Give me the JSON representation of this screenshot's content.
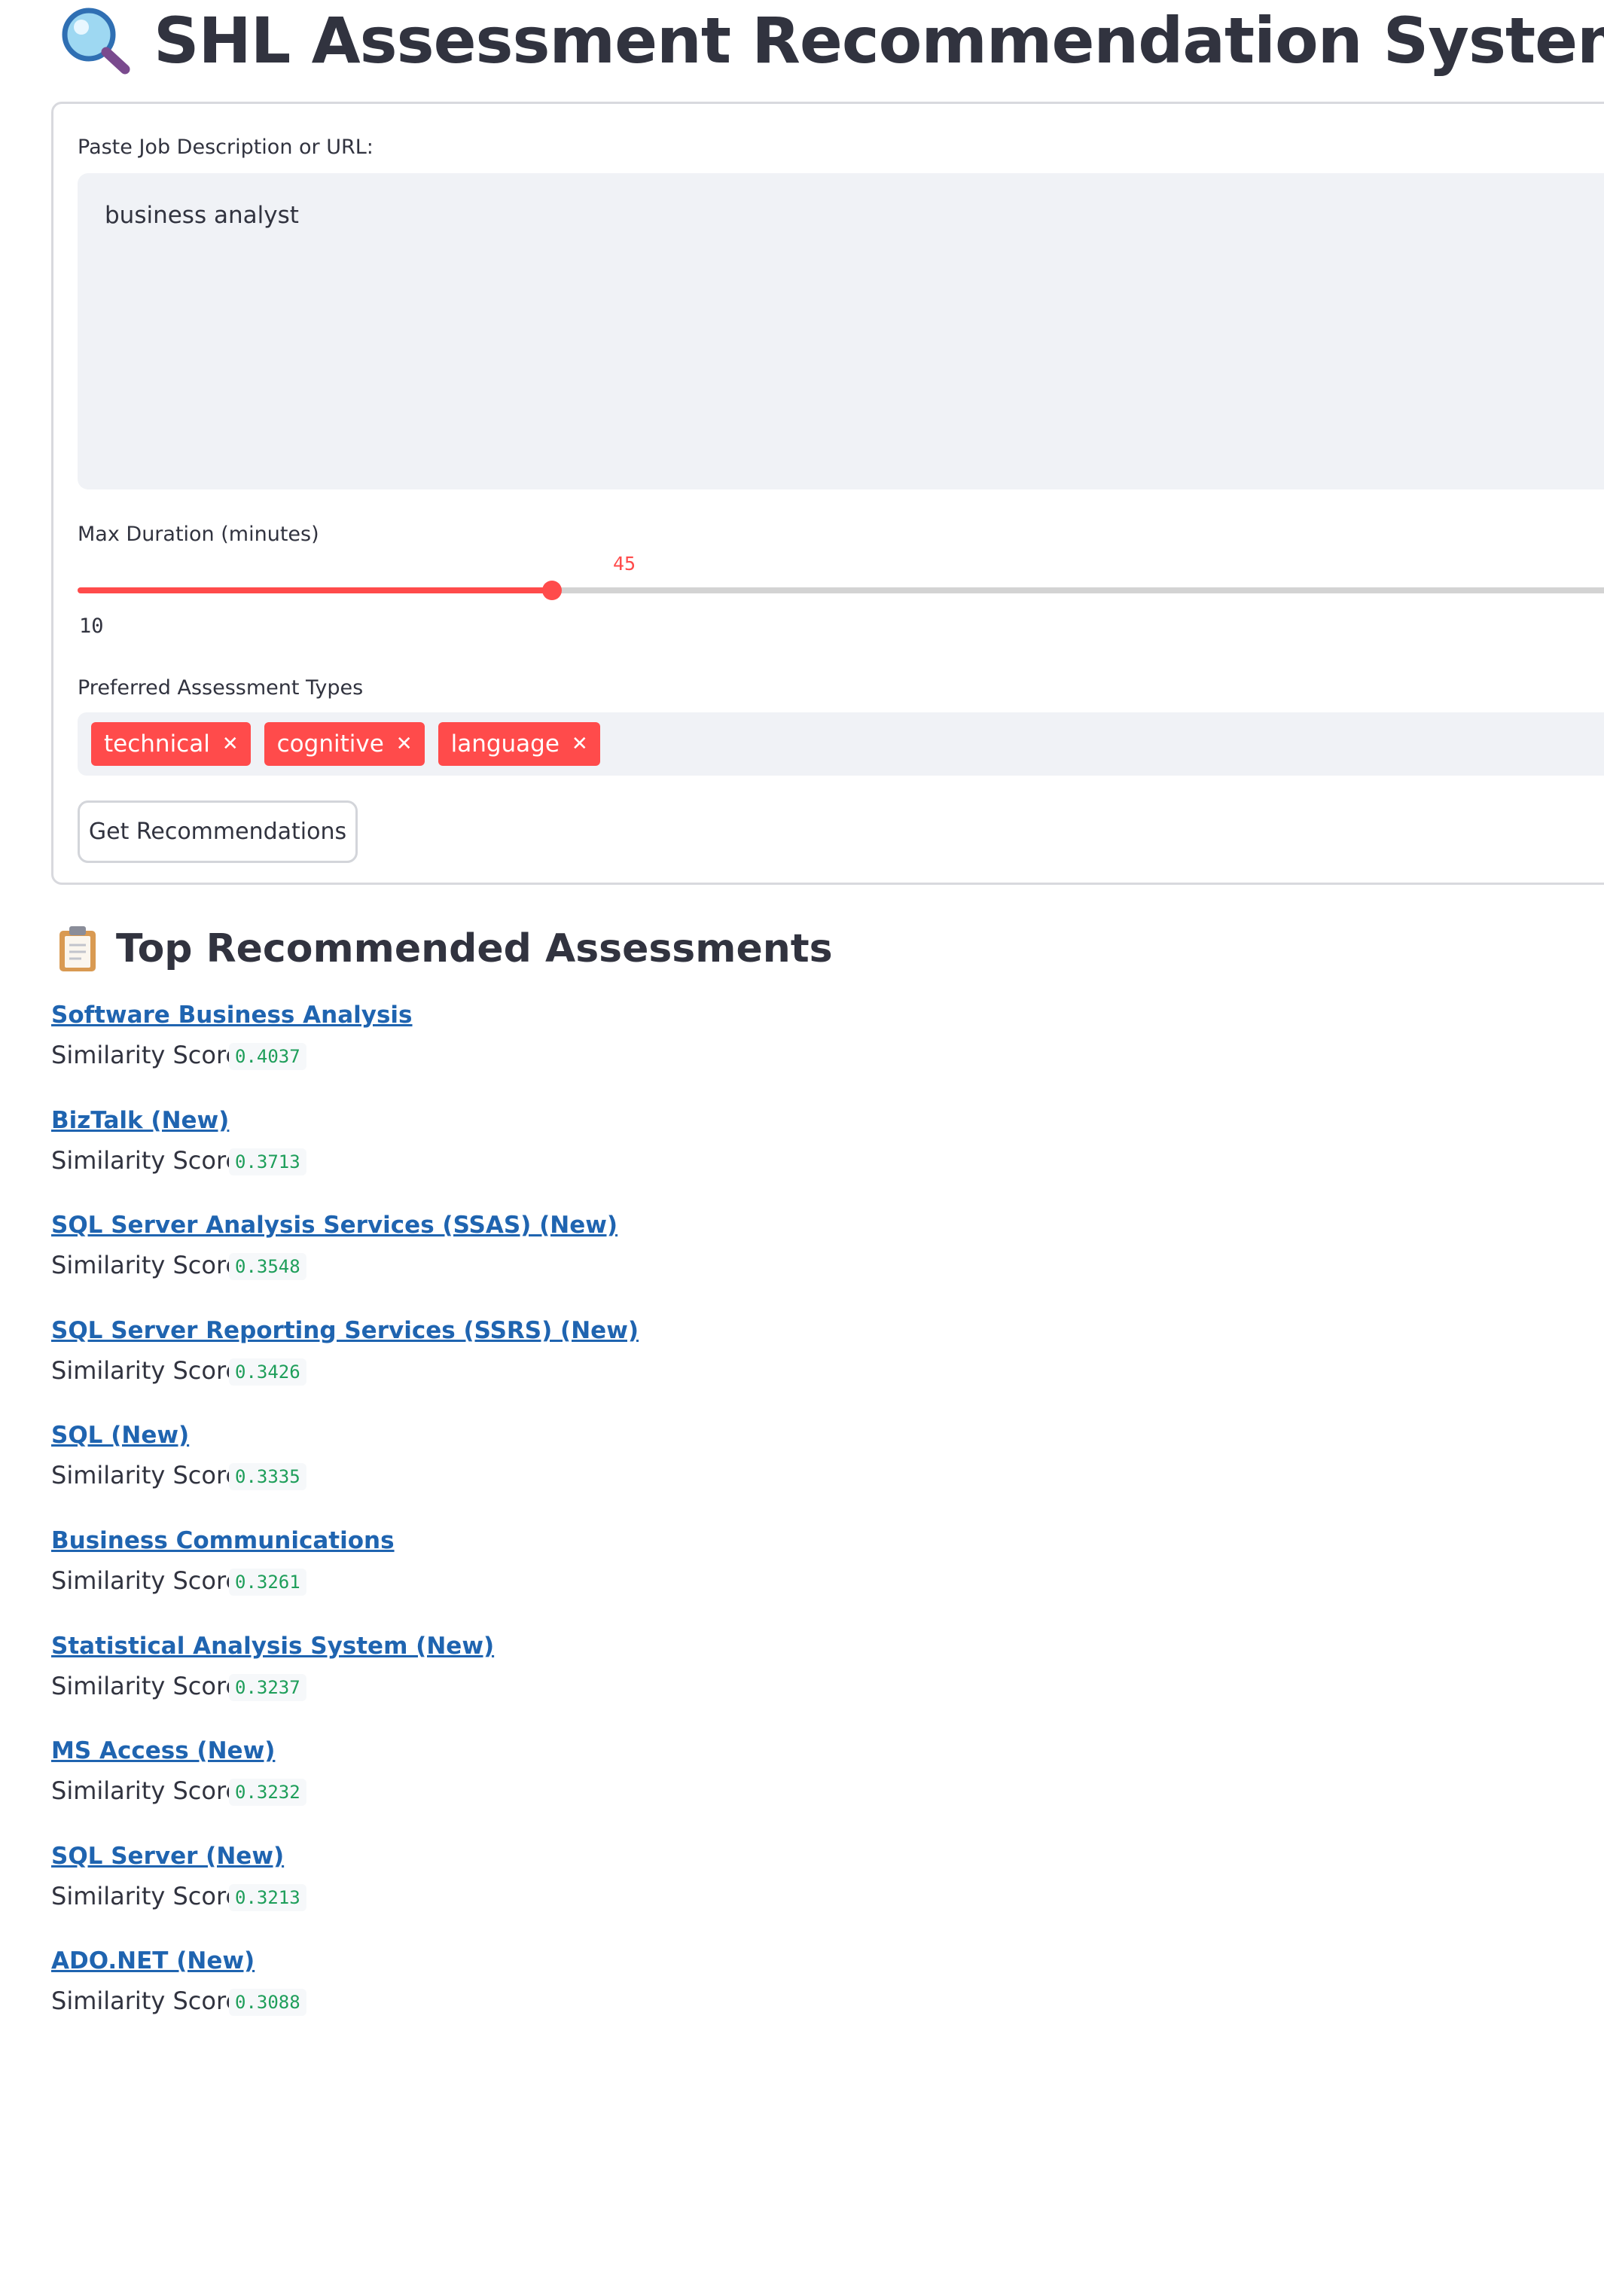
{
  "header": {
    "title": "SHL Assessment Recommendation System",
    "icon": "magnifying-glass-icon"
  },
  "form": {
    "jd_label": "Paste Job Description or URL:",
    "jd_value": "business analyst",
    "duration_label": "Max Duration (minutes)",
    "duration_value": "45",
    "duration_min_label": "10",
    "duration_fraction": 0.3,
    "types_label": "Preferred Assessment Types",
    "types_selected": [
      "technical",
      "cognitive",
      "language"
    ],
    "submit_label": "Get Recommendations"
  },
  "results": {
    "title": "Top Recommended Assessments",
    "icon": "clipboard-icon",
    "score_label": "Similarity Score:",
    "items": [
      {
        "name": "Software Business Analysis",
        "score": "0.4037"
      },
      {
        "name": "BizTalk (New)",
        "score": "0.3713"
      },
      {
        "name": "SQL Server Analysis Services (SSAS) (New)",
        "score": "0.3548"
      },
      {
        "name": "SQL Server Reporting Services (SSRS) (New)",
        "score": "0.3426"
      },
      {
        "name": "SQL (New)",
        "score": "0.3335"
      },
      {
        "name": "Business Communications",
        "score": "0.3261"
      },
      {
        "name": "Statistical Analysis System (New)",
        "score": "0.3237"
      },
      {
        "name": "MS Access (New)",
        "score": "0.3232"
      },
      {
        "name": "SQL Server (New)",
        "score": "0.3213"
      },
      {
        "name": "ADO.NET (New)",
        "score": "0.3088"
      }
    ]
  },
  "colors": {
    "accent": "#ff4b4b",
    "link": "#1f64b0",
    "score": "#1e9e5a",
    "text": "#31333f"
  }
}
